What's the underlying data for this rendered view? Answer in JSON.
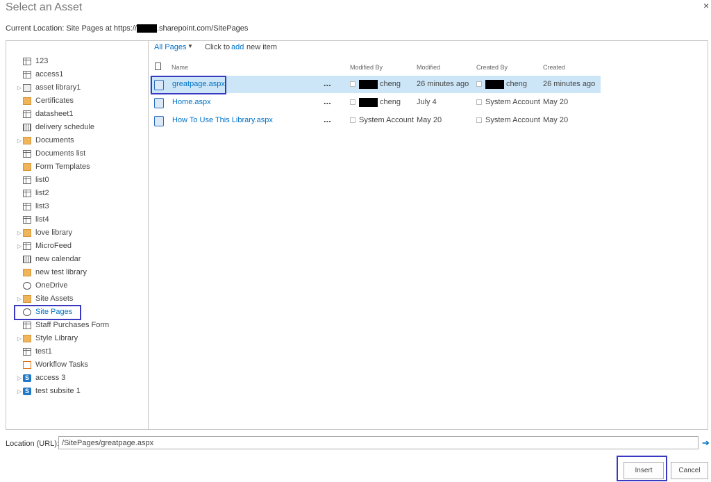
{
  "dialog": {
    "title": "Select an Asset",
    "close_label": "×",
    "location_prefix": "Current Location: Site Pages at https://",
    "location_suffix": ".sharepoint.com/SitePages"
  },
  "tree": {
    "selected": "Site Pages",
    "items": [
      {
        "label": "123",
        "icon": "list-icon",
        "expandable": false
      },
      {
        "label": "access1",
        "icon": "list-icon",
        "expandable": false
      },
      {
        "label": "asset library1",
        "icon": "image-library-icon",
        "expandable": true
      },
      {
        "label": "Certificates",
        "icon": "document-library-icon",
        "expandable": false
      },
      {
        "label": "datasheet1",
        "icon": "list-icon",
        "expandable": false
      },
      {
        "label": "delivery schedule",
        "icon": "calendar-icon",
        "expandable": false
      },
      {
        "label": "Documents",
        "icon": "document-library-icon",
        "expandable": true
      },
      {
        "label": "Documents list",
        "icon": "list-icon",
        "expandable": false
      },
      {
        "label": "Form Templates",
        "icon": "document-library-icon",
        "expandable": false
      },
      {
        "label": "list0",
        "icon": "list-icon",
        "expandable": false
      },
      {
        "label": "list2",
        "icon": "list-icon",
        "expandable": false
      },
      {
        "label": "list3",
        "icon": "list-icon",
        "expandable": false
      },
      {
        "label": "list4",
        "icon": "list-icon",
        "expandable": false
      },
      {
        "label": "love library",
        "icon": "document-library-icon",
        "expandable": true
      },
      {
        "label": "MicroFeed",
        "icon": "list-icon",
        "expandable": true
      },
      {
        "label": "new calendar",
        "icon": "calendar-icon",
        "expandable": false
      },
      {
        "label": "new test library",
        "icon": "document-library-icon",
        "expandable": false
      },
      {
        "label": "OneDrive",
        "icon": "globe-icon",
        "expandable": false
      },
      {
        "label": "Site Assets",
        "icon": "document-library-icon",
        "expandable": true
      },
      {
        "label": "Site Pages",
        "icon": "wiki-icon",
        "expandable": false
      },
      {
        "label": "Staff Purchases Form",
        "icon": "list-icon",
        "expandable": false
      },
      {
        "label": "Style Library",
        "icon": "document-library-icon",
        "expandable": true
      },
      {
        "label": "test1",
        "icon": "list-icon",
        "expandable": false
      },
      {
        "label": "Workflow Tasks",
        "icon": "tasks-icon",
        "expandable": false
      },
      {
        "label": "access 3",
        "icon": "sharepoint-site-icon",
        "expandable": true
      },
      {
        "label": "test subsite 1",
        "icon": "sharepoint-site-icon",
        "expandable": true
      }
    ]
  },
  "toolbar": {
    "view_label": "All Pages",
    "click_to": "Click to",
    "add_label": "add",
    "new_item": "new item"
  },
  "columns": {
    "name": "Name",
    "modified_by": "Modified By",
    "modified": "Modified",
    "created_by": "Created By",
    "created": "Created"
  },
  "files": [
    {
      "name": "greatpage.aspx",
      "modified_by": "cheng",
      "modified_by_redacted": true,
      "modified": "26 minutes ago",
      "created_by": "cheng",
      "created_by_redacted": true,
      "created": "26 minutes ago",
      "selected": true
    },
    {
      "name": "Home.aspx",
      "modified_by": "cheng",
      "modified_by_redacted": true,
      "modified": "July 4",
      "created_by": "System Account",
      "created_by_redacted": false,
      "created": "May 20",
      "selected": false
    },
    {
      "name": "How To Use This Library.aspx",
      "modified_by": "System Account",
      "modified_by_redacted": false,
      "modified": "May 20",
      "created_by": "System Account",
      "created_by_redacted": false,
      "created": "May 20",
      "selected": false
    }
  ],
  "ellipsis": "...",
  "location": {
    "label": "Location (URL):",
    "value": "/SitePages/greatpage.aspx"
  },
  "buttons": {
    "insert": "Insert",
    "cancel": "Cancel"
  },
  "colors": {
    "link": "#0072c6",
    "selection_bg": "#cde6f7",
    "highlight_box": "#3838c0"
  }
}
